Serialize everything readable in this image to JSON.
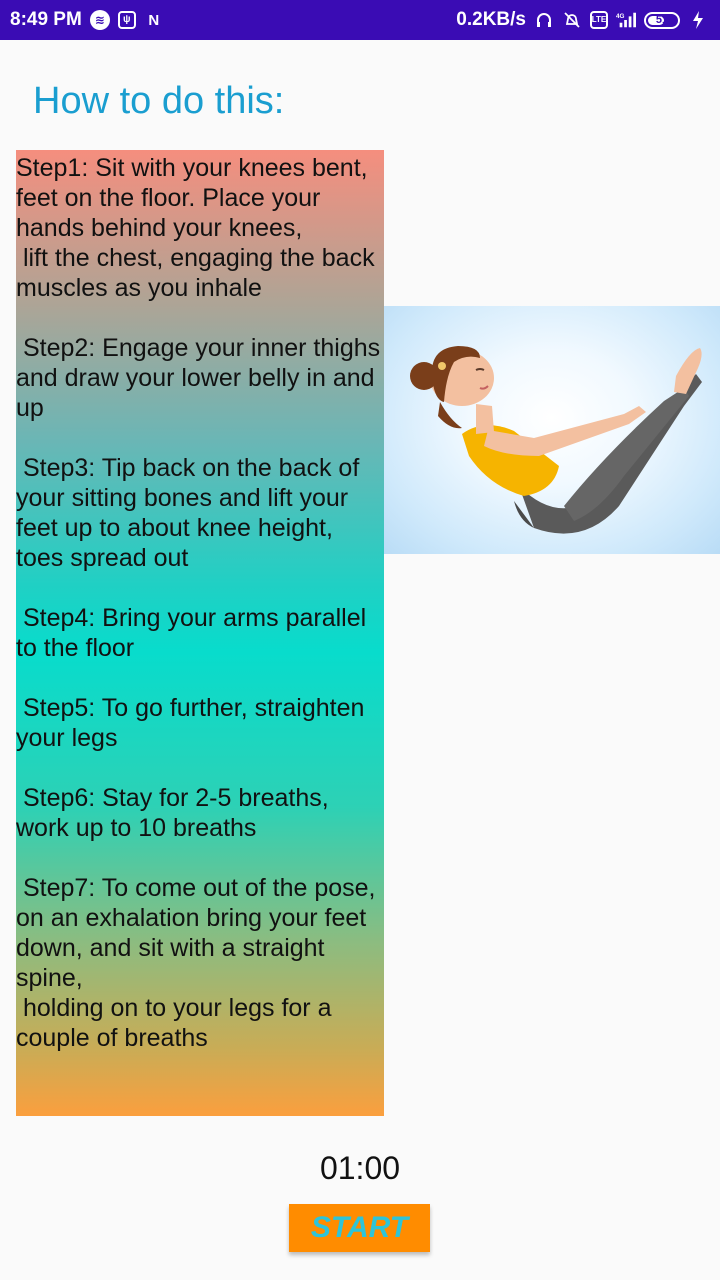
{
  "status_bar": {
    "time": "8:49 PM",
    "net_speed": "0.2KB/s",
    "battery_level": "51",
    "left_icons": [
      "spotify-icon",
      "usb-icon",
      "n-icon"
    ],
    "right_icons": [
      "headphones-icon",
      "alarm-off-icon",
      "volte-icon",
      "signal-4g-icon",
      "battery-icon",
      "charging-icon"
    ]
  },
  "heading": "How to do this:",
  "steps_text": "Step1: Sit with your knees bent, feet on the floor. Place your hands behind your knees,\n lift the chest, engaging the back muscles as you inhale\n\n Step2: Engage your inner thighs and draw your lower belly in and up\n\n Step3: Tip back on the back of your sitting bones and lift your feet up to about knee height, toes spread out\n\n Step4: Bring your arms parallel to the floor\n\n Step5: To go further, straighten your legs\n\n Step6: Stay for 2-5 breaths, work up to 10 breaths\n\n Step7: To come out of the pose, on an exhalation bring your feet down, and sit with a straight spine,\n holding on to your legs for a couple of breaths",
  "timer": "01:00",
  "start_label": "START",
  "colors": {
    "status_bar": "#3a0cb4",
    "heading": "#1a9ed0",
    "start_button": "#ff8c00",
    "start_text": "#2ec4d8"
  }
}
